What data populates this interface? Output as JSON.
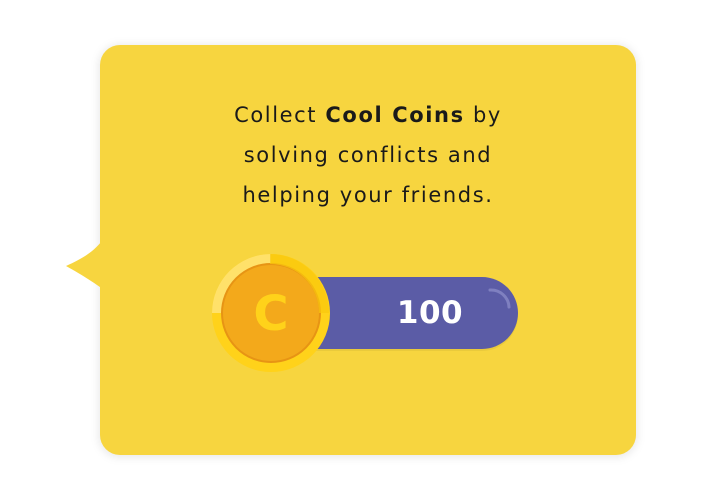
{
  "tooltip": {
    "line1_prefix": "Collect ",
    "line1_bold": "Cool Coins",
    "line1_suffix": " by",
    "line2": "solving conflicts and",
    "line3": "helping your friends."
  },
  "coin_counter": {
    "icon_letter": "C",
    "value": "100"
  },
  "colors": {
    "bubble": "#f7d53f",
    "pill": "#5b5ca6",
    "coin_outer": "#ffd21a",
    "coin_inner": "#f3a91b",
    "coin_letter": "#ffd21a"
  },
  "icons": {
    "coin": "coin-icon"
  }
}
